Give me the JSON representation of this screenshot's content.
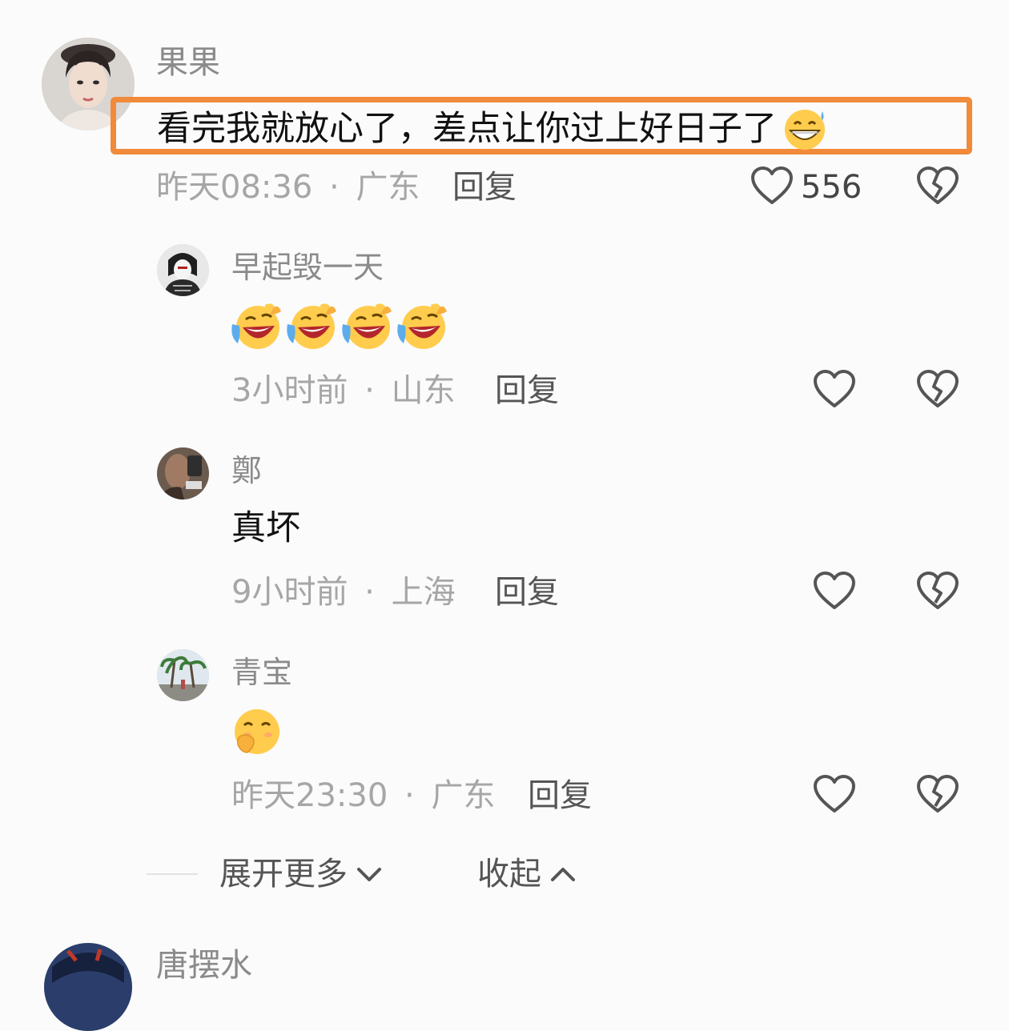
{
  "main_comment": {
    "username": "果果",
    "text": "看完我就放心了，差点让你过上好日子了",
    "time": "昨天08:36",
    "location": "广东",
    "reply_label": "回复",
    "like_count": "556",
    "avatar": "woman-portrait",
    "text_emoji": "grinning-sweat-emoji"
  },
  "replies": [
    {
      "username": "早起毁一天",
      "text": "",
      "emojis": [
        "laughing-crying-emoji",
        "laughing-crying-emoji",
        "laughing-crying-emoji",
        "laughing-crying-emoji"
      ],
      "time": "3小时前",
      "location": "山东",
      "reply_label": "回复"
    },
    {
      "username": "鄭",
      "text": "真坏",
      "emojis": [],
      "time": "9小时前",
      "location": "上海",
      "reply_label": "回复"
    },
    {
      "username": "青宝",
      "text": "",
      "emojis": [
        "giggle-cover-mouth-emoji"
      ],
      "time": "昨天23:30",
      "location": "广东",
      "reply_label": "回复"
    }
  ],
  "footer": {
    "expand_label": "展开更多",
    "collapse_label": "收起"
  },
  "next_comment": {
    "username": "唐摆水"
  },
  "meta_separator": "·",
  "colors": {
    "highlight": "#f18a3a",
    "meta_text": "#a6a6a6",
    "name_text": "#8a8a8a"
  }
}
